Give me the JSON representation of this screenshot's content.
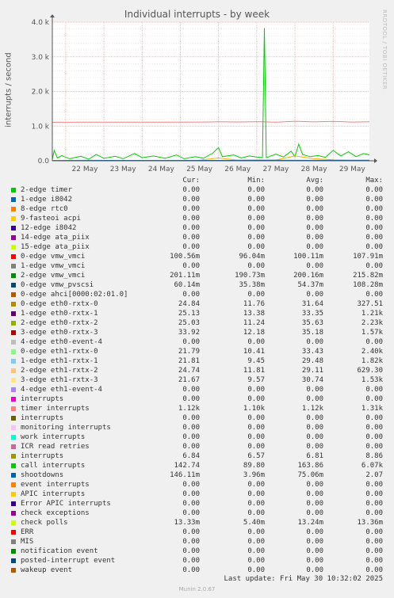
{
  "title": "Individual interrupts - by week",
  "ylabel": "interrupts / second",
  "side_label": "RRDTOOL / TOBI OETIKER",
  "last_update": "Last update: Fri May 30 10:32:02 2025",
  "footer": "Munin 2.0.67",
  "legend_headers": [
    "Cur:",
    "Min:",
    "Avg:",
    "Max:"
  ],
  "chart_data": {
    "type": "line",
    "title": "Individual interrupts - by week",
    "ylabel": "interrupts / second",
    "xlabel": "",
    "x_ticks": [
      "22 May",
      "23 May",
      "24 May",
      "25 May",
      "26 May",
      "27 May",
      "28 May",
      "29 May"
    ],
    "x_range_days": [
      21.65,
      29.95
    ],
    "y_ticks": [
      0,
      1000,
      2000,
      3000,
      4000
    ],
    "y_tick_labels": [
      "0.0",
      "1.0 k",
      "2.0 k",
      "3.0 k",
      "4.0 k"
    ],
    "ylim": [
      0,
      4000
    ],
    "grid": true,
    "series": [
      {
        "name": "timer interrupts",
        "color": "#f08080",
        "points": [
          [
            21.65,
            1110
          ],
          [
            22.5,
            1115
          ],
          [
            23.5,
            1112
          ],
          [
            24.5,
            1115
          ],
          [
            25.5,
            1118
          ],
          [
            26.0,
            1125
          ],
          [
            26.5,
            1120
          ],
          [
            27.0,
            1130
          ],
          [
            27.5,
            1115
          ],
          [
            28.0,
            1140
          ],
          [
            28.5,
            1122
          ],
          [
            29.0,
            1138
          ],
          [
            29.5,
            1118
          ],
          [
            29.95,
            1125
          ]
        ]
      },
      {
        "name": "call interrupts",
        "color": "#00cc00",
        "points": [
          [
            21.65,
            40
          ],
          [
            21.7,
            300
          ],
          [
            21.78,
            80
          ],
          [
            21.9,
            150
          ],
          [
            22.1,
            60
          ],
          [
            22.4,
            130
          ],
          [
            22.6,
            45
          ],
          [
            22.8,
            180
          ],
          [
            23.0,
            70
          ],
          [
            23.3,
            130
          ],
          [
            23.5,
            60
          ],
          [
            23.8,
            210
          ],
          [
            24.0,
            90
          ],
          [
            24.3,
            140
          ],
          [
            24.6,
            70
          ],
          [
            24.9,
            170
          ],
          [
            25.1,
            60
          ],
          [
            25.4,
            120
          ],
          [
            25.6,
            70
          ],
          [
            25.85,
            220
          ],
          [
            26.0,
            380
          ],
          [
            26.1,
            120
          ],
          [
            26.4,
            170
          ],
          [
            26.6,
            80
          ],
          [
            26.8,
            140
          ],
          [
            27.0,
            110
          ],
          [
            27.15,
            90
          ],
          [
            27.2,
            3830
          ],
          [
            27.25,
            90
          ],
          [
            27.5,
            190
          ],
          [
            27.7,
            110
          ],
          [
            27.9,
            280
          ],
          [
            28.0,
            120
          ],
          [
            28.1,
            480
          ],
          [
            28.2,
            180
          ],
          [
            28.4,
            120
          ],
          [
            28.6,
            150
          ],
          [
            28.8,
            100
          ],
          [
            29.0,
            300
          ],
          [
            29.2,
            140
          ],
          [
            29.4,
            260
          ],
          [
            29.6,
            120
          ],
          [
            29.8,
            210
          ],
          [
            29.95,
            170
          ]
        ]
      },
      {
        "name": "eth1-rxtx",
        "color": "#ffb000",
        "points": [
          [
            21.65,
            10
          ],
          [
            22.5,
            15
          ],
          [
            23.5,
            12
          ],
          [
            24.5,
            14
          ],
          [
            25.5,
            18
          ],
          [
            26.0,
            80
          ],
          [
            26.5,
            20
          ],
          [
            27.0,
            25
          ],
          [
            27.5,
            20
          ],
          [
            28.0,
            140
          ],
          [
            28.5,
            60
          ],
          [
            29.0,
            30
          ],
          [
            29.5,
            20
          ],
          [
            29.95,
            25
          ]
        ]
      },
      {
        "name": "eth0-rxtx",
        "color": "#0066b3",
        "points": [
          [
            21.65,
            8
          ],
          [
            23.0,
            12
          ],
          [
            24.5,
            10
          ],
          [
            26.0,
            12
          ],
          [
            27.5,
            15
          ],
          [
            29.0,
            14
          ],
          [
            29.95,
            12
          ]
        ]
      }
    ],
    "legend": [
      {
        "name": "2-edge timer",
        "color": "#00cc00",
        "cur": "0.00",
        "min": "0.00",
        "avg": "0.00",
        "max": "0.00"
      },
      {
        "name": "1-edge i8042",
        "color": "#0066b3",
        "cur": "0.00",
        "min": "0.00",
        "avg": "0.00",
        "max": "0.00"
      },
      {
        "name": "8-edge rtc0",
        "color": "#ff8000",
        "cur": "0.00",
        "min": "0.00",
        "avg": "0.00",
        "max": "0.00"
      },
      {
        "name": "9-fasteoi acpi",
        "color": "#ffcc00",
        "cur": "0.00",
        "min": "0.00",
        "avg": "0.00",
        "max": "0.00"
      },
      {
        "name": "12-edge i8042",
        "color": "#330099",
        "cur": "0.00",
        "min": "0.00",
        "avg": "0.00",
        "max": "0.00"
      },
      {
        "name": "14-edge ata_piix",
        "color": "#990099",
        "cur": "0.00",
        "min": "0.00",
        "avg": "0.00",
        "max": "0.00"
      },
      {
        "name": "15-edge ata_piix",
        "color": "#ccff00",
        "cur": "0.00",
        "min": "0.00",
        "avg": "0.00",
        "max": "0.00"
      },
      {
        "name": "0-edge vmw_vmci",
        "color": "#ff0000",
        "cur": "100.56m",
        "min": "96.04m",
        "avg": "100.11m",
        "max": "107.91m"
      },
      {
        "name": "1-edge vmw_vmci",
        "color": "#808080",
        "cur": "0.00",
        "min": "0.00",
        "avg": "0.00",
        "max": "0.00"
      },
      {
        "name": "2-edge vmw_vmci",
        "color": "#008f00",
        "cur": "201.11m",
        "min": "190.73m",
        "avg": "200.16m",
        "max": "215.82m"
      },
      {
        "name": "0-edge vmw_pvscsi",
        "color": "#00487d",
        "cur": "60.14m",
        "min": "35.38m",
        "avg": "54.37m",
        "max": "108.28m"
      },
      {
        "name": "0-edge ahci[0000:02:01.0]",
        "color": "#b35a00",
        "cur": "0.00",
        "min": "0.00",
        "avg": "0.00",
        "max": "0.00"
      },
      {
        "name": "0-edge eth0-rxtx-0",
        "color": "#b38f00",
        "cur": "24.84",
        "min": "11.76",
        "avg": "31.64",
        "max": "327.51"
      },
      {
        "name": "1-edge eth0-rxtx-1",
        "color": "#6b006b",
        "cur": "25.13",
        "min": "13.38",
        "avg": "33.35",
        "max": "1.21k"
      },
      {
        "name": "2-edge eth0-rxtx-2",
        "color": "#8fb300",
        "cur": "25.03",
        "min": "11.24",
        "avg": "35.63",
        "max": "2.23k"
      },
      {
        "name": "3-edge eth0-rxtx-3",
        "color": "#b30000",
        "cur": "33.92",
        "min": "12.18",
        "avg": "35.18",
        "max": "1.57k"
      },
      {
        "name": "4-edge eth0-event-4",
        "color": "#bebebe",
        "cur": "0.00",
        "min": "0.00",
        "avg": "0.00",
        "max": "0.00"
      },
      {
        "name": "0-edge eth1-rxtx-0",
        "color": "#80ff80",
        "cur": "21.79",
        "min": "10.41",
        "avg": "33.43",
        "max": "2.40k"
      },
      {
        "name": "1-edge eth1-rxtx-1",
        "color": "#80c9ff",
        "cur": "21.81",
        "min": "9.45",
        "avg": "29.48",
        "max": "1.82k"
      },
      {
        "name": "2-edge eth1-rxtx-2",
        "color": "#ffc080",
        "cur": "24.74",
        "min": "11.81",
        "avg": "29.11",
        "max": "629.30"
      },
      {
        "name": "3-edge eth1-rxtx-3",
        "color": "#ffe680",
        "cur": "21.67",
        "min": "9.57",
        "avg": "30.74",
        "max": "1.53k"
      },
      {
        "name": "4-edge eth1-event-4",
        "color": "#aa80ff",
        "cur": "0.00",
        "min": "0.00",
        "avg": "0.00",
        "max": "0.00"
      },
      {
        "name": "interrupts",
        "color": "#ee00cc",
        "cur": "0.00",
        "min": "0.00",
        "avg": "0.00",
        "max": "0.00"
      },
      {
        "name": "timer interrupts",
        "color": "#ff8080",
        "cur": "1.12k",
        "min": "1.10k",
        "avg": "1.12k",
        "max": "1.31k"
      },
      {
        "name": "interrupts",
        "color": "#666600",
        "cur": "0.00",
        "min": "0.00",
        "avg": "0.00",
        "max": "0.00"
      },
      {
        "name": "monitoring interrupts",
        "color": "#ffbfff",
        "cur": "0.00",
        "min": "0.00",
        "avg": "0.00",
        "max": "0.00"
      },
      {
        "name": "work interrupts",
        "color": "#00ffcc",
        "cur": "0.00",
        "min": "0.00",
        "avg": "0.00",
        "max": "0.00"
      },
      {
        "name": "ICR read retries",
        "color": "#cc6699",
        "cur": "0.00",
        "min": "0.00",
        "avg": "0.00",
        "max": "0.00"
      },
      {
        "name": "interrupts",
        "color": "#999900",
        "cur": "6.84",
        "min": "6.57",
        "avg": "6.81",
        "max": "8.86"
      },
      {
        "name": "call interrupts",
        "color": "#00cc00",
        "cur": "142.74",
        "min": "89.80",
        "avg": "163.86",
        "max": "6.07k"
      },
      {
        "name": "shootdowns",
        "color": "#0066b3",
        "cur": "146.11m",
        "min": "3.96m",
        "avg": "75.06m",
        "max": "2.07"
      },
      {
        "name": "event interrupts",
        "color": "#ff8000",
        "cur": "0.00",
        "min": "0.00",
        "avg": "0.00",
        "max": "0.00"
      },
      {
        "name": "APIC interrupts",
        "color": "#ffcc00",
        "cur": "0.00",
        "min": "0.00",
        "avg": "0.00",
        "max": "0.00"
      },
      {
        "name": "Error APIC interrupts",
        "color": "#330099",
        "cur": "0.00",
        "min": "0.00",
        "avg": "0.00",
        "max": "0.00"
      },
      {
        "name": "check exceptions",
        "color": "#990099",
        "cur": "0.00",
        "min": "0.00",
        "avg": "0.00",
        "max": "0.00"
      },
      {
        "name": "check polls",
        "color": "#ccff00",
        "cur": "13.33m",
        "min": "5.40m",
        "avg": "13.24m",
        "max": "13.36m"
      },
      {
        "name": "ERR",
        "color": "#ff0000",
        "cur": "0.00",
        "min": "0.00",
        "avg": "0.00",
        "max": "0.00"
      },
      {
        "name": "MIS",
        "color": "#808080",
        "cur": "0.00",
        "min": "0.00",
        "avg": "0.00",
        "max": "0.00"
      },
      {
        "name": "notification event",
        "color": "#008f00",
        "cur": "0.00",
        "min": "0.00",
        "avg": "0.00",
        "max": "0.00"
      },
      {
        "name": "posted-interrupt event",
        "color": "#00487d",
        "cur": "0.00",
        "min": "0.00",
        "avg": "0.00",
        "max": "0.00"
      },
      {
        "name": "wakeup event",
        "color": "#b35a00",
        "cur": "0.00",
        "min": "0.00",
        "avg": "0.00",
        "max": "0.00"
      }
    ]
  }
}
